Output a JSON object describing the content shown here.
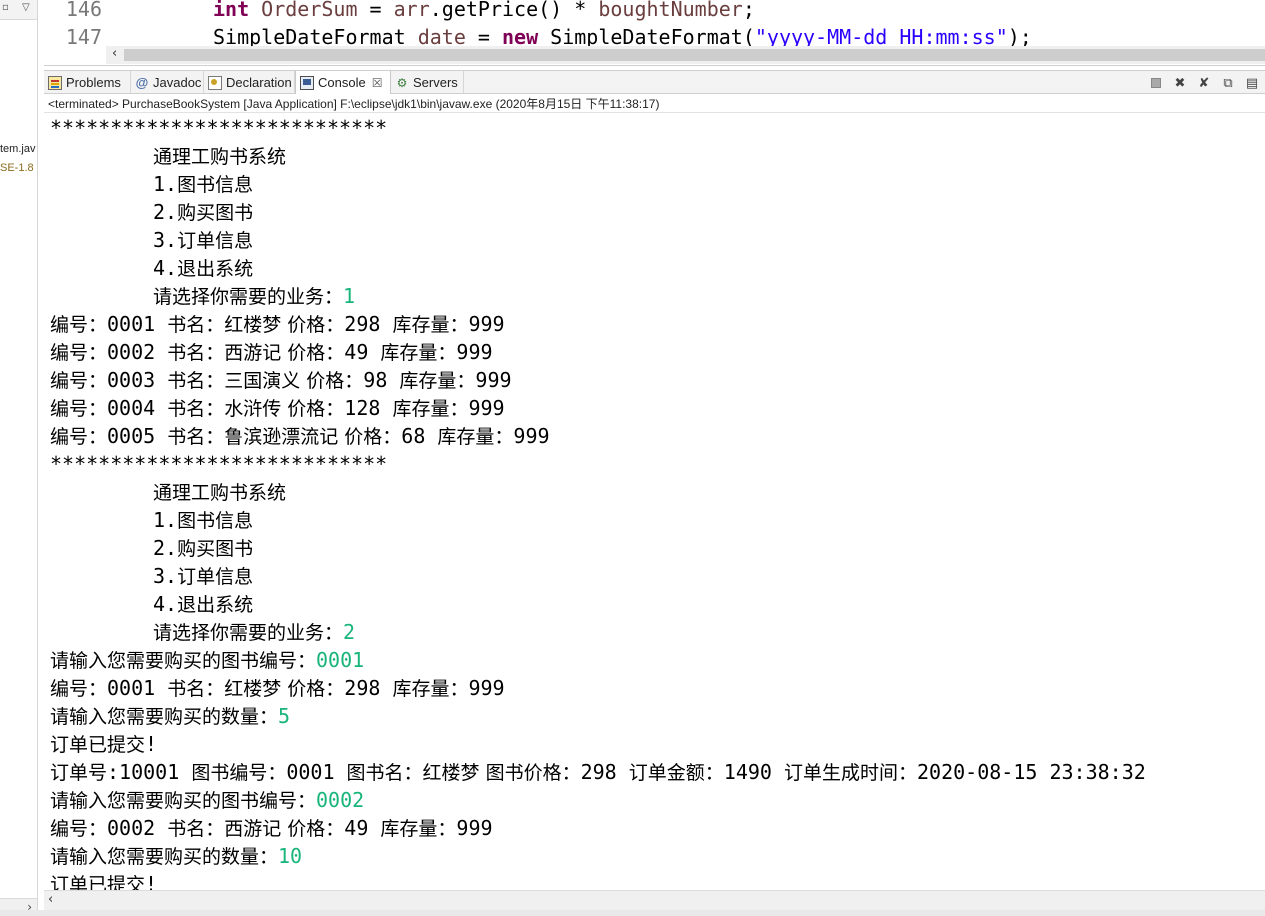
{
  "left_panel": {
    "fragments": [
      "tem.jav",
      "SE-1.8"
    ]
  },
  "editor": {
    "lines": [
      {
        "number": "146",
        "tokens": [
          {
            "text": "int",
            "kind": "kw"
          },
          {
            "text": " ",
            "kind": "plain"
          },
          {
            "text": "OrderSum",
            "kind": "fld"
          },
          {
            "text": " = ",
            "kind": "plain"
          },
          {
            "text": "arr",
            "kind": "fld"
          },
          {
            "text": ".getPrice() * ",
            "kind": "plain"
          },
          {
            "text": "boughtNumber",
            "kind": "fld"
          },
          {
            "text": ";",
            "kind": "plain"
          }
        ]
      },
      {
        "number": "147",
        "tokens": [
          {
            "text": "SimpleDateFormat ",
            "kind": "plain"
          },
          {
            "text": "date",
            "kind": "fld"
          },
          {
            "text": " = ",
            "kind": "plain"
          },
          {
            "text": "new",
            "kind": "kw"
          },
          {
            "text": " SimpleDateFormat(",
            "kind": "plain"
          },
          {
            "text": "\"yyyy-MM-dd HH:mm:ss\"",
            "kind": "str"
          },
          {
            "text": ");",
            "kind": "plain"
          }
        ]
      }
    ]
  },
  "tabs": [
    {
      "label": "Problems",
      "icon": "problems-icon"
    },
    {
      "label": "Javadoc",
      "icon": "javadoc-icon"
    },
    {
      "label": "Declaration",
      "icon": "declaration-icon"
    },
    {
      "label": "Console",
      "icon": "console-icon",
      "active": true,
      "close": "☒"
    },
    {
      "label": "Servers",
      "icon": "servers-icon"
    }
  ],
  "status_line": "<terminated> PurchaseBookSystem [Java Application] F:\\eclipse\\jdk1\\bin\\javaw.exe (2020年8月15日 下午11:38:17)",
  "console": {
    "input_color": "#18b57a",
    "lines": [
      {
        "indent": false,
        "segments": [
          {
            "t": "****************************"
          }
        ]
      },
      {
        "indent": true,
        "segments": [
          {
            "t": "通理工购书系统",
            "cjk": true
          }
        ]
      },
      {
        "indent": true,
        "segments": [
          {
            "t": "1."
          },
          {
            "t": "图书信息",
            "cjk": true
          }
        ]
      },
      {
        "indent": true,
        "segments": [
          {
            "t": "2."
          },
          {
            "t": "购买图书",
            "cjk": true
          }
        ]
      },
      {
        "indent": true,
        "segments": [
          {
            "t": "3."
          },
          {
            "t": "订单信息",
            "cjk": true
          }
        ]
      },
      {
        "indent": true,
        "segments": [
          {
            "t": "4."
          },
          {
            "t": "退出系统",
            "cjk": true
          }
        ]
      },
      {
        "indent": true,
        "segments": [
          {
            "t": "请选择你需要的业务：",
            "cjk": true
          },
          {
            "t": "1",
            "input": true
          }
        ]
      },
      {
        "indent": false,
        "segments": [
          {
            "t": "编号：",
            "cjk": true
          },
          {
            "t": "0001 "
          },
          {
            "t": "书名：红楼梦 价格：",
            "cjk": true
          },
          {
            "t": "298 "
          },
          {
            "t": "库存量：",
            "cjk": true
          },
          {
            "t": "999"
          }
        ]
      },
      {
        "indent": false,
        "segments": [
          {
            "t": "编号：",
            "cjk": true
          },
          {
            "t": "0002 "
          },
          {
            "t": "书名：西游记 价格：",
            "cjk": true
          },
          {
            "t": "49 "
          },
          {
            "t": "库存量：",
            "cjk": true
          },
          {
            "t": "999"
          }
        ]
      },
      {
        "indent": false,
        "segments": [
          {
            "t": "编号：",
            "cjk": true
          },
          {
            "t": "0003 "
          },
          {
            "t": "书名：三国演义 价格：",
            "cjk": true
          },
          {
            "t": "98 "
          },
          {
            "t": "库存量：",
            "cjk": true
          },
          {
            "t": "999"
          }
        ]
      },
      {
        "indent": false,
        "segments": [
          {
            "t": "编号：",
            "cjk": true
          },
          {
            "t": "0004 "
          },
          {
            "t": "书名：水浒传 价格：",
            "cjk": true
          },
          {
            "t": "128 "
          },
          {
            "t": "库存量：",
            "cjk": true
          },
          {
            "t": "999"
          }
        ]
      },
      {
        "indent": false,
        "segments": [
          {
            "t": "编号：",
            "cjk": true
          },
          {
            "t": "0005 "
          },
          {
            "t": "书名：鲁滨逊漂流记 价格：",
            "cjk": true
          },
          {
            "t": "68 "
          },
          {
            "t": "库存量：",
            "cjk": true
          },
          {
            "t": "999"
          }
        ]
      },
      {
        "indent": false,
        "segments": [
          {
            "t": "****************************"
          }
        ]
      },
      {
        "indent": true,
        "segments": [
          {
            "t": "通理工购书系统",
            "cjk": true
          }
        ]
      },
      {
        "indent": true,
        "segments": [
          {
            "t": "1."
          },
          {
            "t": "图书信息",
            "cjk": true
          }
        ]
      },
      {
        "indent": true,
        "segments": [
          {
            "t": "2."
          },
          {
            "t": "购买图书",
            "cjk": true
          }
        ]
      },
      {
        "indent": true,
        "segments": [
          {
            "t": "3."
          },
          {
            "t": "订单信息",
            "cjk": true
          }
        ]
      },
      {
        "indent": true,
        "segments": [
          {
            "t": "4."
          },
          {
            "t": "退出系统",
            "cjk": true
          }
        ]
      },
      {
        "indent": true,
        "segments": [
          {
            "t": "请选择你需要的业务：",
            "cjk": true
          },
          {
            "t": "2",
            "input": true
          }
        ]
      },
      {
        "indent": false,
        "segments": [
          {
            "t": "请输入您需要购买的图书编号：",
            "cjk": true
          },
          {
            "t": "0001",
            "input": true
          }
        ]
      },
      {
        "indent": false,
        "segments": [
          {
            "t": "编号：",
            "cjk": true
          },
          {
            "t": "0001 "
          },
          {
            "t": "书名：红楼梦 价格：",
            "cjk": true
          },
          {
            "t": "298 "
          },
          {
            "t": "库存量：",
            "cjk": true
          },
          {
            "t": "999"
          }
        ]
      },
      {
        "indent": false,
        "segments": [
          {
            "t": "请输入您需要购买的数量：",
            "cjk": true
          },
          {
            "t": "5",
            "input": true
          }
        ]
      },
      {
        "indent": false,
        "segments": [
          {
            "t": "订单已提交",
            "cjk": true
          },
          {
            "t": "!"
          }
        ]
      },
      {
        "indent": false,
        "segments": [
          {
            "t": "订单号",
            "cjk": true
          },
          {
            "t": ":10001 "
          },
          {
            "t": "图书编号：",
            "cjk": true
          },
          {
            "t": "0001 "
          },
          {
            "t": "图书名：红楼梦 图书价格：",
            "cjk": true
          },
          {
            "t": "298 "
          },
          {
            "t": "订单金额：",
            "cjk": true
          },
          {
            "t": "1490 "
          },
          {
            "t": "订单生成时间：",
            "cjk": true
          },
          {
            "t": "2020-08-15 23:38:32"
          }
        ]
      },
      {
        "indent": false,
        "segments": [
          {
            "t": "请输入您需要购买的图书编号：",
            "cjk": true
          },
          {
            "t": "0002",
            "input": true
          }
        ]
      },
      {
        "indent": false,
        "segments": [
          {
            "t": "编号：",
            "cjk": true
          },
          {
            "t": "0002 "
          },
          {
            "t": "书名：西游记 价格：",
            "cjk": true
          },
          {
            "t": "49 "
          },
          {
            "t": "库存量：",
            "cjk": true
          },
          {
            "t": "999"
          }
        ]
      },
      {
        "indent": false,
        "segments": [
          {
            "t": "请输入您需要购买的数量：",
            "cjk": true
          },
          {
            "t": "10",
            "input": true
          }
        ]
      },
      {
        "indent": false,
        "segments": [
          {
            "t": "订单已提交",
            "cjk": true
          },
          {
            "t": "!"
          }
        ]
      }
    ]
  }
}
